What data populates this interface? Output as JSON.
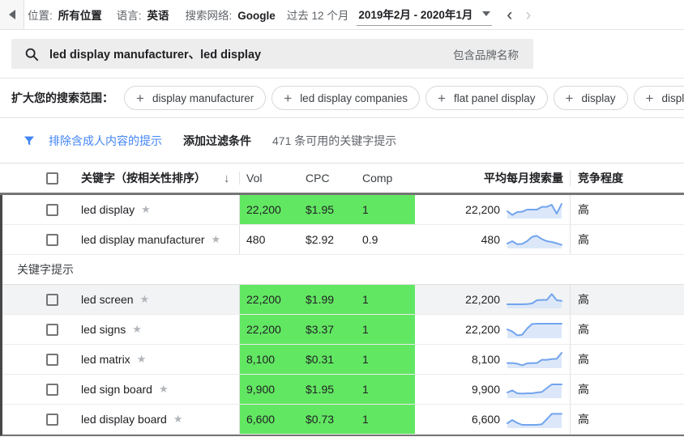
{
  "topbar": {
    "location_label": "位置:",
    "location_value": "所有位置",
    "language_label": "语言:",
    "language_value": "英语",
    "network_label": "搜索网络:",
    "network_value": "Google",
    "period_label": "过去 12 个月",
    "period_value": "2019年2月 - 2020年1月",
    "prev_arrow": "‹",
    "next_arrow": "›"
  },
  "search": {
    "query": "led display manufacturer、led display",
    "brand_hint": "包含品牌名称"
  },
  "broaden": {
    "label": "扩大您的搜索范围：",
    "chips": [
      "display manufacturer",
      "led display companies",
      "flat panel display",
      "display",
      "display technology"
    ],
    "partial_chip_visible": true,
    "plus_glyph": "+"
  },
  "filterbar": {
    "exclude_adult_label": "排除含成人内容的提示",
    "add_filter_label": "添加过滤条件",
    "available_count_label": "471 条可用的关键字提示"
  },
  "table": {
    "headers": {
      "keyword": "关键字（按相关性排序）",
      "sort_glyph": "↓",
      "vol": "Vol",
      "cpc": "CPC",
      "comp": "Comp",
      "avg_monthly": "平均每月搜索量",
      "competition": "竞争程度"
    },
    "section_label": "关键字提示",
    "star_glyph": "★",
    "top_rows": [
      {
        "keyword": "led display",
        "vol": "22,200",
        "cpc": "$1.95",
        "comp": "1",
        "avg": "22,200",
        "competition": "高",
        "highlighted": true,
        "hovered": false,
        "spark": [
          0.45,
          0.22,
          0.4,
          0.42,
          0.55,
          0.55,
          0.55,
          0.72,
          0.72,
          0.85,
          0.3,
          0.9
        ]
      },
      {
        "keyword": "led display manufacturer",
        "vol": "480",
        "cpc": "$2.92",
        "comp": "0.9",
        "avg": "480",
        "competition": "高",
        "highlighted": false,
        "hovered": false,
        "spark": [
          0.3,
          0.45,
          0.26,
          0.28,
          0.45,
          0.72,
          0.78,
          0.58,
          0.45,
          0.4,
          0.32,
          0.22
        ]
      }
    ],
    "suggestion_rows": [
      {
        "keyword": "led screen",
        "vol": "22,200",
        "cpc": "$1.99",
        "comp": "1",
        "avg": "22,200",
        "competition": "高",
        "highlighted": true,
        "hovered": true,
        "spark": [
          0.25,
          0.25,
          0.25,
          0.25,
          0.26,
          0.3,
          0.5,
          0.52,
          0.52,
          0.88,
          0.5,
          0.46
        ]
      },
      {
        "keyword": "led signs",
        "vol": "22,200",
        "cpc": "$3.37",
        "comp": "1",
        "avg": "22,200",
        "competition": "高",
        "highlighted": true,
        "hovered": false,
        "spark": [
          0.55,
          0.42,
          0.18,
          0.22,
          0.6,
          0.88,
          0.9,
          0.9,
          0.9,
          0.9,
          0.9,
          0.9
        ]
      },
      {
        "keyword": "led matrix",
        "vol": "8,100",
        "cpc": "$0.31",
        "comp": "1",
        "avg": "8,100",
        "competition": "高",
        "highlighted": true,
        "hovered": false,
        "spark": [
          0.32,
          0.32,
          0.28,
          0.18,
          0.3,
          0.32,
          0.32,
          0.52,
          0.52,
          0.56,
          0.58,
          0.95
        ]
      },
      {
        "keyword": "led sign board",
        "vol": "9,900",
        "cpc": "$1.95",
        "comp": "1",
        "avg": "9,900",
        "competition": "高",
        "highlighted": true,
        "hovered": false,
        "spark": [
          0.35,
          0.48,
          0.3,
          0.28,
          0.3,
          0.3,
          0.35,
          0.38,
          0.62,
          0.85,
          0.85,
          0.85
        ]
      },
      {
        "keyword": "led display board",
        "vol": "6,600",
        "cpc": "$0.73",
        "comp": "1",
        "avg": "6,600",
        "competition": "高",
        "highlighted": true,
        "hovered": false,
        "spark": [
          0.3,
          0.5,
          0.32,
          0.2,
          0.2,
          0.2,
          0.2,
          0.24,
          0.55,
          0.88,
          0.88,
          0.88
        ]
      }
    ]
  },
  "colors": {
    "highlight_green": "#62e762",
    "link_blue": "#4285f4",
    "spark_stroke": "#72a4ee",
    "spark_fill": "#dce8f9"
  }
}
